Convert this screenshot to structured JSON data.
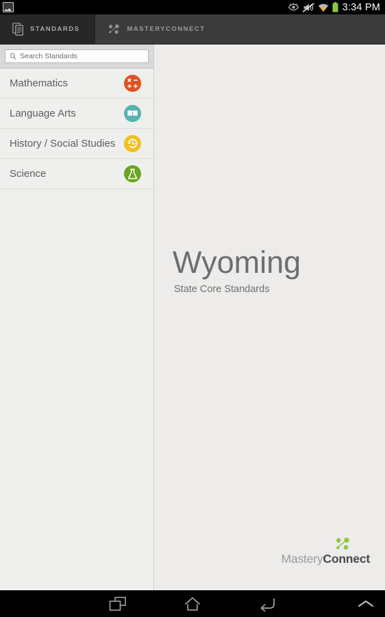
{
  "status_bar": {
    "notification_icon": "screenshot-image-icon",
    "icons": [
      "eye-icon",
      "volume-mute-icon",
      "wifi-icon",
      "battery-icon"
    ],
    "time": "3:34 PM",
    "battery_color": "#8cc63f"
  },
  "tabs": [
    {
      "id": "standards",
      "label": "STANDARDS",
      "icon": "documents-icon",
      "active": true
    },
    {
      "id": "masteryconnect",
      "label": "MASTERYCONNECT",
      "icon": "nodes-icon",
      "active": false
    }
  ],
  "search": {
    "placeholder": "Search Standards",
    "value": "",
    "icon": "search-icon"
  },
  "sidebar": {
    "subjects": [
      {
        "label": "Mathematics",
        "icon": "math-operators-icon",
        "color": "#e0521f"
      },
      {
        "label": "Language Arts",
        "icon": "open-book-icon",
        "color": "#57b3b0"
      },
      {
        "label": "History / Social Studies",
        "icon": "clock-history-icon",
        "color": "#f0c020"
      },
      {
        "label": "Science",
        "icon": "flask-icon",
        "color": "#6aa420"
      }
    ]
  },
  "content": {
    "state_name": "Wyoming",
    "state_subtitle": "State Core Standards"
  },
  "brand": {
    "name_light": "Mastery",
    "name_bold": "Connect",
    "logo_icon": "nodes-logo-icon",
    "logo_color": "#8cc63f"
  },
  "nav_bar": {
    "buttons": [
      {
        "id": "recents",
        "icon": "recents-icon"
      },
      {
        "id": "home",
        "icon": "home-icon"
      },
      {
        "id": "back",
        "icon": "back-icon"
      },
      {
        "id": "expand",
        "icon": "chevron-up-icon"
      }
    ]
  }
}
